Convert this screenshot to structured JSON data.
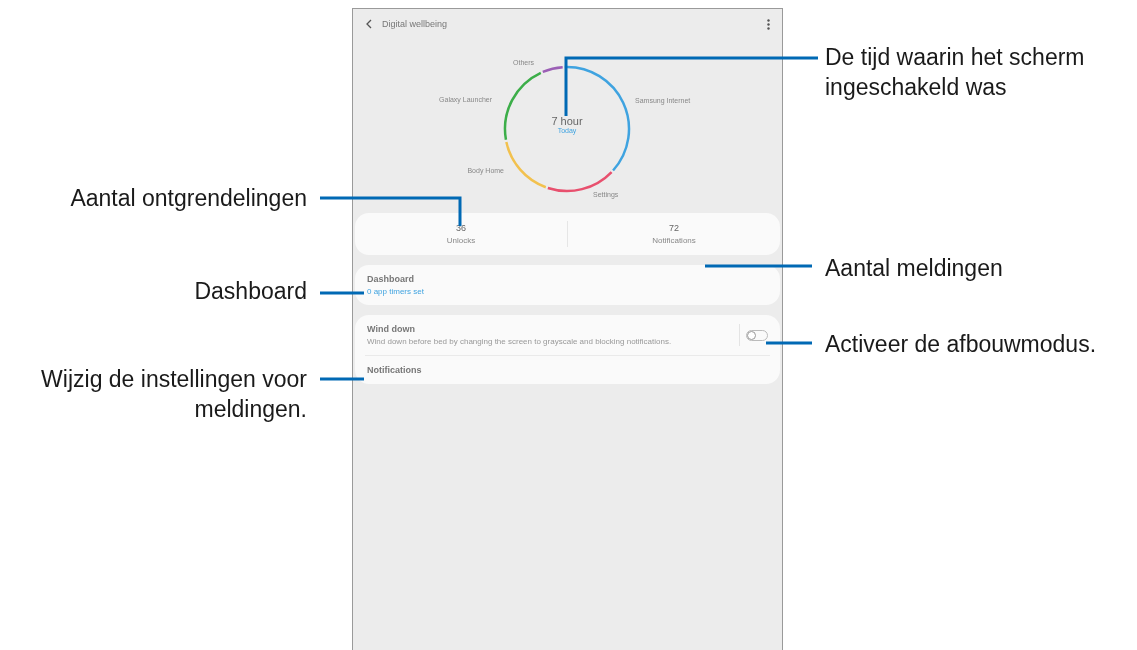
{
  "header": {
    "title": "Digital wellbeing"
  },
  "usage": {
    "total": "7 hour",
    "period": "Today",
    "apps": [
      {
        "name": "Samsung Internet",
        "color": "#3fa3e0"
      },
      {
        "name": "Settings",
        "color": "#e8506e"
      },
      {
        "name": "Body Home",
        "color": "#f2c14e"
      },
      {
        "name": "Galaxy Launcher",
        "color": "#3cae49"
      },
      {
        "name": "Others",
        "color": "#9b5fb5"
      }
    ]
  },
  "stats": [
    {
      "value": "36",
      "label": "Unlocks"
    },
    {
      "value": "72",
      "label": "Notifications"
    }
  ],
  "dashboard": {
    "title": "Dashboard",
    "subtitle": "0 app timers set"
  },
  "wind_down": {
    "title": "Wind down",
    "description": "Wind down before bed by changing the screen to grayscale and blocking notifications.",
    "on": false
  },
  "notifications": {
    "title": "Notifications"
  },
  "callouts": [
    {
      "text": "De tijd waarin het scherm ingeschakeld was"
    },
    {
      "text": "Aantal ontgrendelingen"
    },
    {
      "text": "Aantal meldingen"
    },
    {
      "text": "Dashboard"
    },
    {
      "text": "Activeer de afbouwmodus."
    },
    {
      "text": "Wijzig de instellingen voor meldingen."
    }
  ]
}
